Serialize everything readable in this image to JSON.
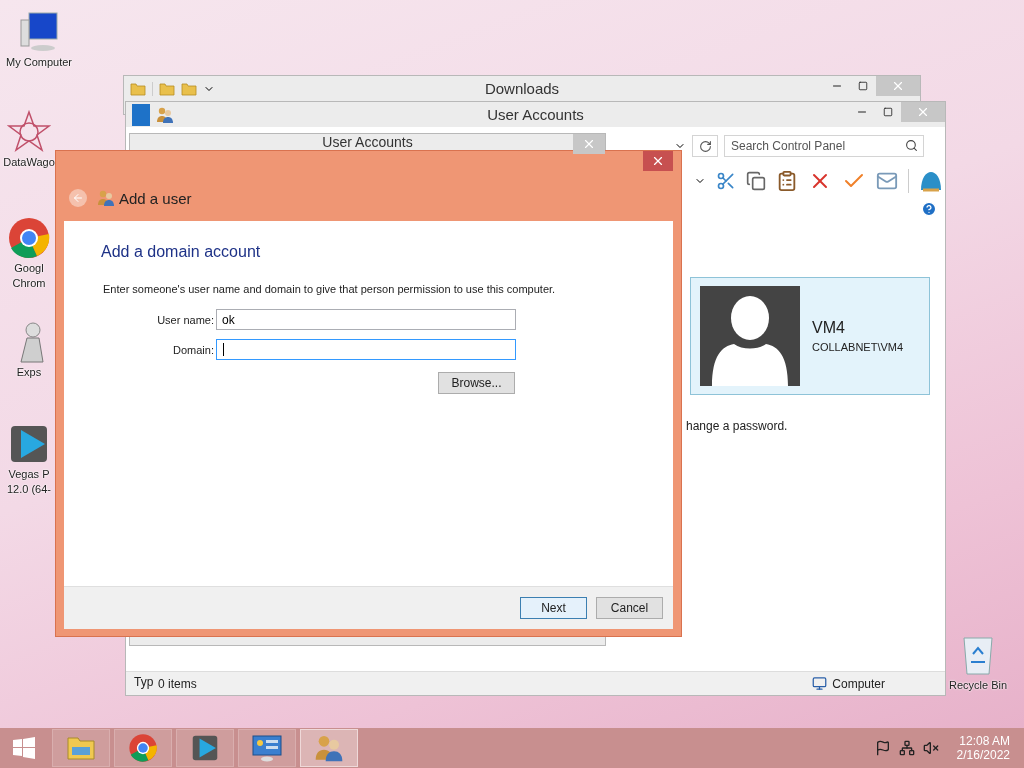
{
  "desktop_icons": [
    {
      "kind": "computer",
      "lines": [
        "My Computer"
      ]
    },
    {
      "kind": "rosette",
      "lines": [
        "DataWago"
      ]
    },
    {
      "kind": "chrome",
      "lines": [
        "Googl",
        "Chrom"
      ]
    },
    {
      "kind": "figure",
      "lines": [
        "Exps"
      ]
    },
    {
      "kind": "player",
      "lines": [
        "Vegas P",
        "12.0 (64-"
      ]
    }
  ],
  "recycle_bin": {
    "label": "Recycle Bin"
  },
  "downloads_window": {
    "title": "Downloads"
  },
  "control_panel_window": {
    "title": "User Accounts",
    "search": {
      "placeholder": "Search Control Panel"
    },
    "user_card": {
      "name": "VM4",
      "account": "COLLABNET\\VM4"
    },
    "link": "hange a password.",
    "column_label": "Typ",
    "status_bar": {
      "items": "0 items",
      "location": "Computer"
    }
  },
  "user_accounts_dialog": {
    "title": "User Accounts"
  },
  "add_user_dialog": {
    "title": "Add a user",
    "heading": "Add a domain account",
    "description": "Enter someone's user name and domain to give that person permission to use this computer.",
    "fields": [
      {
        "label": "User name:",
        "value": "ok",
        "focused": false
      },
      {
        "label": "Domain:",
        "focused": true
      }
    ],
    "browse_button": "Browse...",
    "buttons": [
      {
        "label": "Next",
        "kind": "primary"
      },
      {
        "label": "Cancel",
        "kind": "secondary"
      }
    ]
  },
  "taskbar": {
    "apps": [
      {
        "kind": "explorer",
        "selected": false
      },
      {
        "kind": "chrome",
        "selected": false
      },
      {
        "kind": "player",
        "selected": false
      },
      {
        "kind": "control-panel",
        "selected": false
      },
      {
        "kind": "users",
        "selected": true
      }
    ],
    "clock": {
      "time": "12:08 AM",
      "date": "2/16/2022"
    }
  }
}
